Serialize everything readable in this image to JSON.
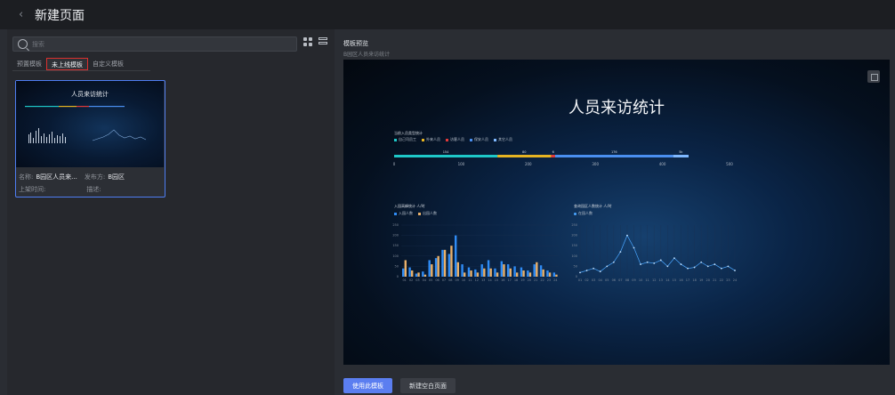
{
  "header": {
    "title": "新建页面"
  },
  "search": {
    "placeholder": "搜索"
  },
  "tabs": [
    {
      "label": "预置模板"
    },
    {
      "label": "未上线模板",
      "active": true
    },
    {
      "label": "自定义模板"
    }
  ],
  "card": {
    "thumb_title": "人员来访统计",
    "name_label": "名称:",
    "name_value": "B园区人员来...",
    "publisher_label": "发布方:",
    "publisher_value": "B园区",
    "time_label": "上架时间:",
    "desc_label": "描述:"
  },
  "preview": {
    "heading": "模板预览",
    "subheading": "B园区人员来访统计",
    "title": "人员来访统计"
  },
  "chart_data": [
    {
      "type": "bar",
      "title": "当前入员类型统计",
      "legend": [
        "自己司员工",
        "外来人员",
        "访客人员",
        "保安人员",
        "其它人员"
      ],
      "colors": [
        "#1ec8c8",
        "#e6b422",
        "#e03a3a",
        "#4a8ff0",
        "#7fb8ff"
      ],
      "values": [
        154,
        80,
        6,
        176,
        23
      ],
      "xticks": [
        "0",
        "100",
        "200",
        "300",
        "400",
        "500"
      ],
      "xlim": [
        0,
        500
      ],
      "value_labels": [
        "154",
        "80",
        "6",
        "176",
        "5k"
      ]
    },
    {
      "type": "bar",
      "title": "入园高峰统计 人/时",
      "legend": [
        "入园人数",
        "出园人数"
      ],
      "colors": [
        "#2f8cf5",
        "#e8b06a"
      ],
      "categories": [
        "01",
        "02",
        "03",
        "04",
        "05",
        "06",
        "07",
        "08",
        "09",
        "10",
        "11",
        "12",
        "13",
        "14",
        "15",
        "16",
        "17",
        "18",
        "19",
        "20",
        "21",
        "22",
        "23",
        "24"
      ],
      "series": [
        {
          "name": "入园人数",
          "values": [
            40,
            45,
            15,
            25,
            80,
            90,
            130,
            110,
            200,
            60,
            45,
            35,
            60,
            80,
            40,
            75,
            60,
            50,
            45,
            30,
            60,
            55,
            30,
            20
          ]
        },
        {
          "name": "出园人数",
          "values": [
            80,
            30,
            20,
            10,
            60,
            100,
            130,
            150,
            70,
            20,
            30,
            20,
            40,
            40,
            20,
            60,
            40,
            20,
            30,
            20,
            70,
            35,
            20,
            10
          ]
        }
      ],
      "yticks": [
        "0",
        "50",
        "100",
        "150",
        "200",
        "250"
      ],
      "ylim": [
        0,
        250
      ]
    },
    {
      "type": "line",
      "title": "查询园区人数统计 人/时",
      "legend": [
        "在园人数"
      ],
      "colors": [
        "#4aa6ff"
      ],
      "categories": [
        "01",
        "02",
        "03",
        "04",
        "05",
        "06",
        "07",
        "08",
        "09",
        "10",
        "11",
        "12",
        "13",
        "14",
        "15",
        "16",
        "17",
        "18",
        "19",
        "20",
        "21",
        "22",
        "23",
        "24"
      ],
      "series": [
        {
          "name": "在园人数",
          "values": [
            20,
            30,
            40,
            25,
            50,
            70,
            120,
            200,
            140,
            60,
            70,
            65,
            80,
            50,
            90,
            60,
            40,
            45,
            70,
            50,
            60,
            40,
            50,
            30
          ]
        }
      ],
      "yticks": [
        "0",
        "50",
        "100",
        "150",
        "200",
        "250"
      ],
      "ylim": [
        0,
        250
      ]
    }
  ],
  "actions": {
    "use_template": "使用此模板",
    "new_blank": "新建空白页面"
  }
}
